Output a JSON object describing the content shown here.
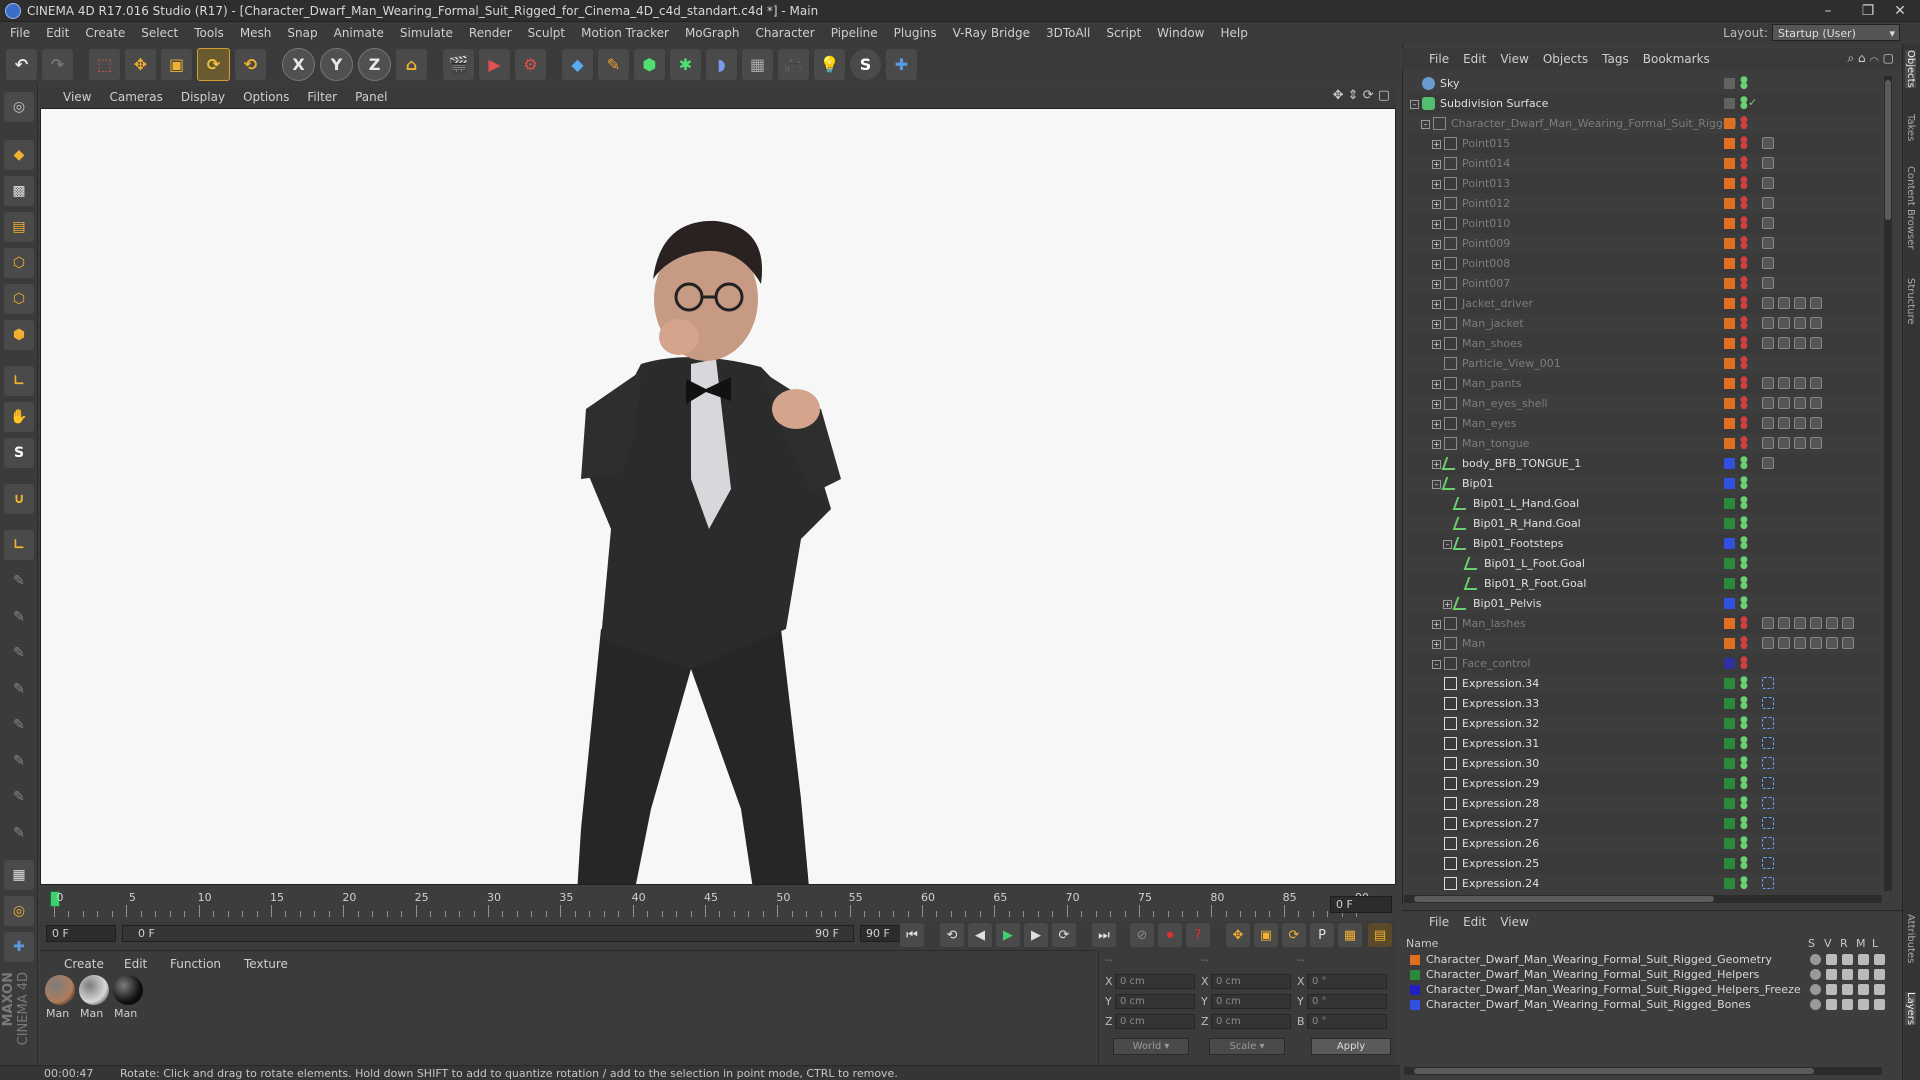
{
  "window": {
    "title": "CINEMA 4D R17.016 Studio (R17) - [Character_Dwarf_Man_Wearing_Formal_Suit_Rigged_for_Cinema_4D_c4d_standart.c4d *] - Main"
  },
  "menubar": {
    "items": [
      "File",
      "Edit",
      "Create",
      "Select",
      "Tools",
      "Mesh",
      "Snap",
      "Animate",
      "Simulate",
      "Render",
      "Sculpt",
      "Motion Tracker",
      "MoGraph",
      "Character",
      "Pipeline",
      "Plugins",
      "V-Ray Bridge",
      "3DToAll",
      "Script",
      "Window",
      "Help"
    ],
    "layout_label": "Layout:",
    "layout_value": "Startup (User)"
  },
  "viewport": {
    "menu": [
      "View",
      "Cameras",
      "Display",
      "Options",
      "Filter",
      "Panel"
    ]
  },
  "timeline": {
    "ticks": [
      "0",
      "5",
      "10",
      "15",
      "20",
      "25",
      "30",
      "35",
      "40",
      "45",
      "50",
      "55",
      "60",
      "65",
      "70",
      "75",
      "80",
      "85",
      "90"
    ],
    "current_frame_display": "0 F",
    "start_field": "0 F",
    "range_start": "0 F",
    "range_end": "90 F",
    "end_field": "90 F"
  },
  "materials": {
    "menu": [
      "Create",
      "Edit",
      "Function",
      "Texture"
    ],
    "items": [
      {
        "label": "Man",
        "color": "#b07c5c"
      },
      {
        "label": "Man",
        "color": "#d8d8d8"
      },
      {
        "label": "Man",
        "color": "#111111"
      }
    ]
  },
  "coords": {
    "rows": [
      {
        "axis": "X",
        "pos": "0 cm",
        "axis2": "X",
        "size": "0 cm",
        "axis3": "X",
        "rot": "0 °"
      },
      {
        "axis": "Y",
        "pos": "0 cm",
        "axis2": "Y",
        "size": "0 cm",
        "axis3": "Y",
        "rot": "0 °"
      },
      {
        "axis": "Z",
        "pos": "0 cm",
        "axis2": "Z",
        "size": "0 cm",
        "axis3": "B",
        "rot": "0 °"
      }
    ],
    "header_dashes": "--",
    "world": "World",
    "scale": "Scale",
    "apply": "Apply"
  },
  "status": {
    "time": "00:00:47",
    "message": "Rotate: Click and drag to rotate elements. Hold down SHIFT to add to quantize rotation / add to the selection in point mode, CTRL to remove."
  },
  "object_manager": {
    "menu": [
      "File",
      "Edit",
      "View",
      "Objects",
      "Tags",
      "Bookmarks"
    ],
    "objects": [
      {
        "name": "Sky",
        "level": 0,
        "active": true,
        "layer": "",
        "tree": ""
      },
      {
        "name": "Subdivision Surface",
        "level": 0,
        "active": true,
        "layer": "",
        "tree": "-"
      },
      {
        "name": "Character_Dwarf_Man_Wearing_Formal_Suit_Rigged",
        "level": 1,
        "active": false,
        "layer": "#e07020",
        "tree": "-"
      },
      {
        "name": "Point015",
        "level": 2,
        "active": false,
        "layer": "#e07020",
        "tree": "+"
      },
      {
        "name": "Point014",
        "level": 2,
        "active": false,
        "layer": "#e07020",
        "tree": "+"
      },
      {
        "name": "Point013",
        "level": 2,
        "active": false,
        "layer": "#e07020",
        "tree": "+"
      },
      {
        "name": "Point012",
        "level": 2,
        "active": false,
        "layer": "#e07020",
        "tree": "+"
      },
      {
        "name": "Point010",
        "level": 2,
        "active": false,
        "layer": "#e07020",
        "tree": "+"
      },
      {
        "name": "Point009",
        "level": 2,
        "active": false,
        "layer": "#e07020",
        "tree": "+"
      },
      {
        "name": "Point008",
        "level": 2,
        "active": false,
        "layer": "#e07020",
        "tree": "+"
      },
      {
        "name": "Point007",
        "level": 2,
        "active": false,
        "layer": "#e07020",
        "tree": "+"
      },
      {
        "name": "Jacket_driver",
        "level": 2,
        "active": false,
        "layer": "#e07020",
        "tree": "+"
      },
      {
        "name": "Man_jacket",
        "level": 2,
        "active": false,
        "layer": "#e07020",
        "tree": "+"
      },
      {
        "name": "Man_shoes",
        "level": 2,
        "active": false,
        "layer": "#e07020",
        "tree": "+"
      },
      {
        "name": "Particle_View_001",
        "level": 2,
        "active": false,
        "layer": "#e07020",
        "tree": ""
      },
      {
        "name": "Man_pants",
        "level": 2,
        "active": false,
        "layer": "#e07020",
        "tree": "+"
      },
      {
        "name": "Man_eyes_shell",
        "level": 2,
        "active": false,
        "layer": "#e07020",
        "tree": "+"
      },
      {
        "name": "Man_eyes",
        "level": 2,
        "active": false,
        "layer": "#e07020",
        "tree": "+"
      },
      {
        "name": "Man_tongue",
        "level": 2,
        "active": false,
        "layer": "#e07020",
        "tree": "+"
      },
      {
        "name": "body_BFB_TONGUE_1",
        "level": 2,
        "active": true,
        "layer": "#3050e0",
        "tree": "+"
      },
      {
        "name": "Bip01",
        "level": 2,
        "active": true,
        "layer": "#3050e0",
        "tree": "-"
      },
      {
        "name": "Bip01_L_Hand.Goal",
        "level": 3,
        "active": true,
        "layer": "#2a8a3a",
        "tree": ""
      },
      {
        "name": "Bip01_R_Hand.Goal",
        "level": 3,
        "active": true,
        "layer": "#2a8a3a",
        "tree": ""
      },
      {
        "name": "Bip01_Footsteps",
        "level": 3,
        "active": true,
        "layer": "#3050e0",
        "tree": "-"
      },
      {
        "name": "Bip01_L_Foot.Goal",
        "level": 4,
        "active": true,
        "layer": "#2a8a3a",
        "tree": ""
      },
      {
        "name": "Bip01_R_Foot.Goal",
        "level": 4,
        "active": true,
        "layer": "#2a8a3a",
        "tree": ""
      },
      {
        "name": "Bip01_Pelvis",
        "level": 3,
        "active": true,
        "layer": "#3050e0",
        "tree": "+"
      },
      {
        "name": "Man_lashes",
        "level": 2,
        "active": false,
        "layer": "#e07020",
        "tree": "+"
      },
      {
        "name": "Man",
        "level": 2,
        "active": false,
        "layer": "#e07020",
        "tree": "+"
      },
      {
        "name": "Face_control",
        "level": 2,
        "active": false,
        "layer": "#3030a0",
        "tree": "-"
      },
      {
        "name": "Expression.34",
        "level": 2,
        "active": true,
        "layer": "#2a8a3a",
        "tree": ""
      },
      {
        "name": "Expression.33",
        "level": 2,
        "active": true,
        "layer": "#2a8a3a",
        "tree": ""
      },
      {
        "name": "Expression.32",
        "level": 2,
        "active": true,
        "layer": "#2a8a3a",
        "tree": ""
      },
      {
        "name": "Expression.31",
        "level": 2,
        "active": true,
        "layer": "#2a8a3a",
        "tree": ""
      },
      {
        "name": "Expression.30",
        "level": 2,
        "active": true,
        "layer": "#2a8a3a",
        "tree": ""
      },
      {
        "name": "Expression.29",
        "level": 2,
        "active": true,
        "layer": "#2a8a3a",
        "tree": ""
      },
      {
        "name": "Expression.28",
        "level": 2,
        "active": true,
        "layer": "#2a8a3a",
        "tree": ""
      },
      {
        "name": "Expression.27",
        "level": 2,
        "active": true,
        "layer": "#2a8a3a",
        "tree": ""
      },
      {
        "name": "Expression.26",
        "level": 2,
        "active": true,
        "layer": "#2a8a3a",
        "tree": ""
      },
      {
        "name": "Expression.25",
        "level": 2,
        "active": true,
        "layer": "#2a8a3a",
        "tree": ""
      },
      {
        "name": "Expression.24",
        "level": 2,
        "active": true,
        "layer": "#2a8a3a",
        "tree": ""
      }
    ]
  },
  "layer_manager": {
    "menu": [
      "File",
      "Edit",
      "View"
    ],
    "header_name": "Name",
    "cols": [
      "S",
      "V",
      "R",
      "M",
      "L"
    ],
    "layers": [
      {
        "name": "Character_Dwarf_Man_Wearing_Formal_Suit_Rigged_Geometry",
        "color": "#e07020"
      },
      {
        "name": "Character_Dwarf_Man_Wearing_Formal_Suit_Rigged_Helpers",
        "color": "#2a8a3a"
      },
      {
        "name": "Character_Dwarf_Man_Wearing_Formal_Suit_Rigged_Helpers_Freeze",
        "color": "#2020c0"
      },
      {
        "name": "Character_Dwarf_Man_Wearing_Formal_Suit_Rigged_Bones",
        "color": "#3050e0"
      }
    ]
  },
  "right_tabs": [
    "Objects",
    "Takes",
    "Content Browser",
    "Structure"
  ],
  "right_tabs_lower": [
    "Attributes",
    "Layers"
  ],
  "brand": {
    "left1": "MAXON",
    "left2": "CINEMA 4D"
  },
  "colors": {
    "accent": "#e8a020",
    "bg": "#3d3d3d",
    "viewport": "#f7f7f7"
  }
}
